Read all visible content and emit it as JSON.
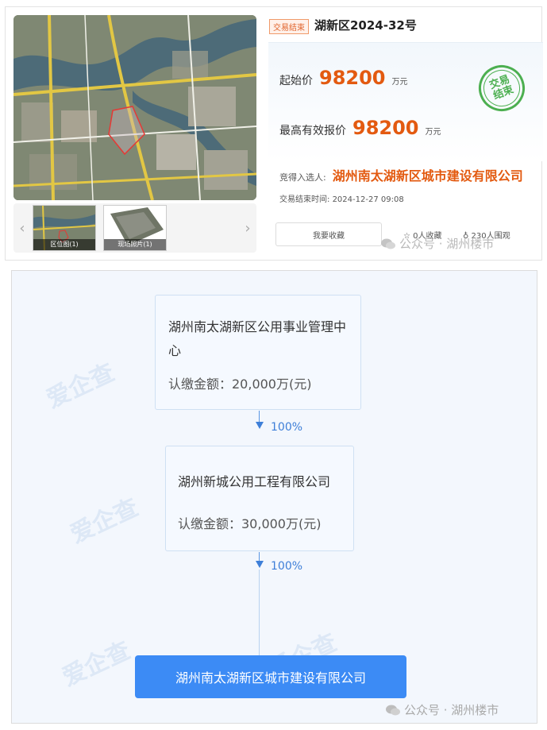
{
  "listing": {
    "status_tag": "交易结束",
    "title": "湖新区2024-32号",
    "start_price_label": "起始价",
    "start_price": "98200",
    "start_price_unit": "万元",
    "highest_bid_label": "最高有效报价",
    "highest_bid": "98200",
    "highest_bid_unit": "万元",
    "stamp_text": "交易结束",
    "winner_label": "竞得入选人:",
    "winner_name": "湖州南太湖新区城市建设有限公司",
    "end_time_label": "交易结束时间:",
    "end_time": "2024-12-27 09:08",
    "favorite_button": "我要收藏",
    "favorites": "0人收藏",
    "views": "230人围观",
    "thumbnails": [
      {
        "label": "区位图(1)"
      },
      {
        "label": "现场照片(1)"
      }
    ],
    "watermark": "公众号 · 湖州楼市"
  },
  "chart": {
    "shareholder_1": {
      "name": "湖州南太湖新区公用事业管理中心",
      "amount": "认缴金额：20,000万(元)"
    },
    "edge_1_percent": "100%",
    "shareholder_2": {
      "name": "湖州新城公用工程有限公司",
      "amount": "认缴金额：30,000万(元)"
    },
    "edge_2_percent": "100%",
    "target_company": "湖州南太湖新区城市建设有限公司",
    "watermark_brand": "爱企查",
    "watermark": "公众号 · 湖州楼市"
  }
}
